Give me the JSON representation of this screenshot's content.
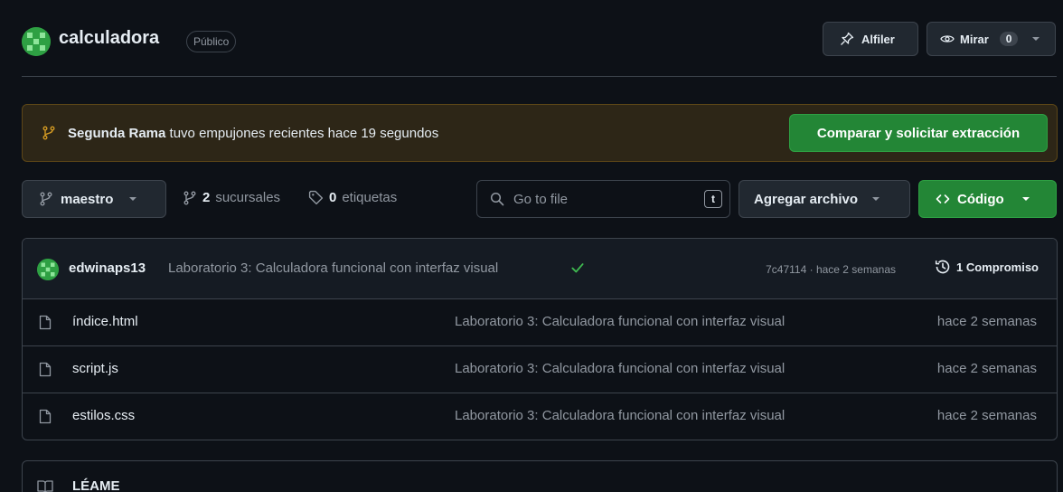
{
  "repo": {
    "name": "calculadora",
    "visibility": "Público",
    "pin_label": "Alfiler",
    "watch_label": "Mirar",
    "watch_count": "0"
  },
  "banner": {
    "branch": "Segunda Rama",
    "text": "tuvo empujones recientes hace 19 segundos",
    "button": "Comparar y solicitar extracción"
  },
  "toolbar": {
    "branch": "maestro",
    "branches_count": "2",
    "branches_label": "sucursales",
    "tags_count": "0",
    "tags_label": "etiquetas",
    "search_placeholder": "Go to file",
    "search_kbd": "t",
    "add_file": "Agregar archivo",
    "code": "Código"
  },
  "commit": {
    "author": "edwinaps13",
    "message": "Laboratorio 3: Calculadora funcional con interfaz visual",
    "hash_time": "7c47114 · hace 2 semanas",
    "history": "1 Compromiso"
  },
  "files": [
    {
      "name": "índice.html",
      "message": "Laboratorio 3: Calculadora funcional con interfaz visual",
      "date": "hace 2 semanas"
    },
    {
      "name": "script.js",
      "message": "Laboratorio 3: Calculadora funcional con interfaz visual",
      "date": "hace 2 semanas"
    },
    {
      "name": "estilos.css",
      "message": "Laboratorio 3: Calculadora funcional con interfaz visual",
      "date": "hace 2 semanas"
    }
  ],
  "readme": {
    "title": "LÉAME"
  },
  "colors": {
    "background": "#0d1117",
    "accent_green": "#238636",
    "banner_bg": "#2d2617",
    "muted": "#9198a1"
  },
  "icons": [
    "repo-avatar",
    "pin-icon",
    "eye-icon",
    "branch-icon",
    "tag-icon",
    "search-icon",
    "code-icon",
    "check-icon",
    "history-icon",
    "file-icon",
    "book-icon"
  ]
}
